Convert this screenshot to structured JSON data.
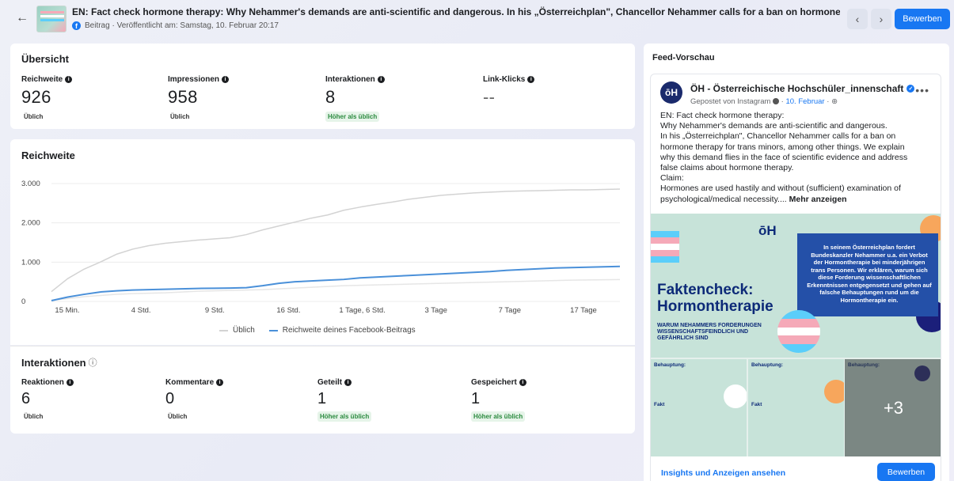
{
  "header": {
    "title": "EN: Fact check hormone therapy: Why Nehammer's demands are anti-scientific and dangerous. In his „Österreichplan\", Chancellor Nehammer calls for a ban on hormone thera...",
    "subtitle": "Beitrag · Veröffentlicht am: Samstag, 10. Februar 20:17",
    "back_icon": "←",
    "prev_icon": "‹",
    "next_icon": "›",
    "boost_label": "Bewerben"
  },
  "overview": {
    "title": "Übersicht",
    "metrics": [
      {
        "label": "Reichweite",
        "value": "926",
        "badge": "Üblich",
        "badge_type": "neutral"
      },
      {
        "label": "Impressionen",
        "value": "958",
        "badge": "Üblich",
        "badge_type": "neutral"
      },
      {
        "label": "Interaktionen",
        "value": "8",
        "badge": "Höher als üblich",
        "badge_type": "good"
      },
      {
        "label": "Link-Klicks",
        "value": "--",
        "badge": "",
        "badge_type": "none"
      }
    ]
  },
  "reach": {
    "title": "Reichweite",
    "legend": {
      "usual": "Üblich",
      "post": "Reichweite deines Facebook-Beitrags"
    }
  },
  "chart_data": {
    "type": "line",
    "title": "Reichweite",
    "x_tick_labels": [
      "15 Min.",
      "4 Std.",
      "9 Std.",
      "16 Std.",
      "1 Tage, 6 Std.",
      "3 Tage",
      "7 Tage",
      "17 Tage"
    ],
    "y_tick_labels": [
      "0",
      "1.000",
      "2.000",
      "3.000"
    ],
    "ylim": [
      0,
      3000
    ],
    "grid": true,
    "legend_placement": "bottom-center",
    "x": [
      0,
      1,
      2,
      3,
      4,
      5,
      6,
      7,
      8,
      9,
      10,
      11,
      12,
      13,
      14,
      15,
      16,
      17,
      18,
      19,
      20,
      21,
      22,
      23,
      24,
      25,
      26,
      27,
      28,
      29,
      30,
      31,
      32,
      33,
      34,
      35
    ],
    "series": [
      {
        "name": "Üblich",
        "color": "#d3d3d3",
        "values": [
          250,
          580,
          820,
          1000,
          1200,
          1330,
          1420,
          1480,
          1520,
          1560,
          1590,
          1620,
          1700,
          1820,
          1920,
          2020,
          2120,
          2200,
          2320,
          2400,
          2470,
          2530,
          2600,
          2650,
          2700,
          2730,
          2760,
          2780,
          2800,
          2810,
          2820,
          2830,
          2840,
          2840,
          2850,
          2860
        ]
      },
      {
        "name": "Üblich (unterer Bereich)",
        "color": "#e6e6e6",
        "values": [
          30,
          70,
          120,
          150,
          180,
          200,
          210,
          220,
          240,
          260,
          270,
          280,
          290,
          300,
          320,
          340,
          360,
          380,
          400,
          410,
          420,
          430,
          440,
          450,
          460,
          470,
          480,
          490,
          500,
          510,
          520,
          530,
          540,
          545,
          550,
          555
        ]
      },
      {
        "name": "Reichweite deines Facebook-Beitrags",
        "color": "#4a90d9",
        "values": [
          20,
          110,
          180,
          240,
          270,
          290,
          300,
          310,
          320,
          330,
          335,
          340,
          350,
          400,
          460,
          500,
          520,
          540,
          560,
          600,
          620,
          640,
          660,
          680,
          700,
          720,
          740,
          760,
          790,
          810,
          830,
          850,
          860,
          870,
          880,
          890
        ]
      }
    ]
  },
  "interactions": {
    "title": "Interaktionen",
    "title_icon": "ⓘ",
    "metrics": [
      {
        "label": "Reaktionen",
        "value": "6",
        "badge": "Üblich",
        "badge_type": "neutral"
      },
      {
        "label": "Kommentare",
        "value": "0",
        "badge": "Üblich",
        "badge_type": "neutral"
      },
      {
        "label": "Geteilt",
        "value": "1",
        "badge": "Höher als üblich",
        "badge_type": "good"
      },
      {
        "label": "Gespeichert",
        "value": "1",
        "badge": "Höher als üblich",
        "badge_type": "good"
      }
    ]
  },
  "feed": {
    "title": "Feed-Vorschau",
    "avatar_text": "ōH",
    "page_name": "ÖH - Österreichische Hochschüler_innenschaft",
    "posted_prefix": "Gepostet von Instagram",
    "posted_date": "10. Februar",
    "more_icon": "•••",
    "post_lines": [
      "EN: Fact check hormone therapy:",
      "Why Nehammer's demands are anti-scientific and dangerous.",
      "In his „Österreichplan\", Chancellor Nehammer calls for a ban on",
      "hormone therapy for trans minors, among other things. We explain",
      "why this demand flies in the face of scientific evidence and address",
      "false claims about hormone therapy.",
      "Claim:"
    ],
    "post_last_line": "Hormones are used hastily and without (sufficient) examination of",
    "post_last_line2": "psychological/medical necessity....",
    "see_more": "Mehr anzeigen",
    "image": {
      "logo": "ōH",
      "heading_line1": "Faktencheck:",
      "heading_line2": "Hormontherapie",
      "small_heading": "WARUM NEHAMMERS FORDERUNGEN WISSENSCHAFTSFEINDLICH UND GEFÄHRLICH SIND",
      "box_text": "In seinem Österreichplan fordert Bundeskanzler Nehammer u.a. ein Verbot der Hormontherapie bei minderjährigen trans Personen. Wir erklären, warum sich diese Forderung wissenschaftlichen Erkenntnissen entgegensetzt und gehen auf falsche Behauptungen rund um die Hormontherapie ein.",
      "tile_label": "Behauptung:",
      "tile_fakt": "Fakt",
      "more_count": "+3"
    },
    "footer_link": "Insights und Anzeigen ansehen",
    "boost_label": "Bewerben"
  },
  "colors": {
    "accent": "#1877f2",
    "good_badge_bg": "#e6f4e9",
    "good_badge_text": "#2a8a3e",
    "series_post": "#4a90d9",
    "series_usual": "#d3d3d3",
    "brand_navy": "#0d2a78"
  }
}
